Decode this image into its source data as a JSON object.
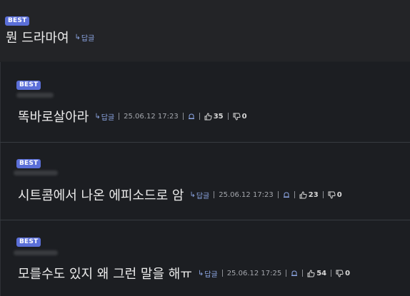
{
  "best_label": "BEST",
  "reply_label": "답글",
  "top_comment": {
    "text": "뭔 드라마여"
  },
  "replies": [
    {
      "text": "똑바로살아라",
      "date": "25.06.12 17:23",
      "likes": "35",
      "dislikes": "0"
    },
    {
      "text": "시트콤에서 나온 에피소드로 암",
      "date": "25.06.12 17:23",
      "likes": "23",
      "dislikes": "0"
    },
    {
      "text": "모를수도 있지 왜 그런 말을 해ㅠ",
      "date": "25.06.12 17:25",
      "likes": "54",
      "dislikes": "0"
    }
  ],
  "colors": {
    "badge": "#5b6fd8",
    "reply_link": "#8ea8e6",
    "background": "#1f2124"
  },
  "icons": [
    "reply-arrow-icon",
    "bell-report-icon",
    "thumbs-up-icon",
    "thumbs-down-icon"
  ]
}
